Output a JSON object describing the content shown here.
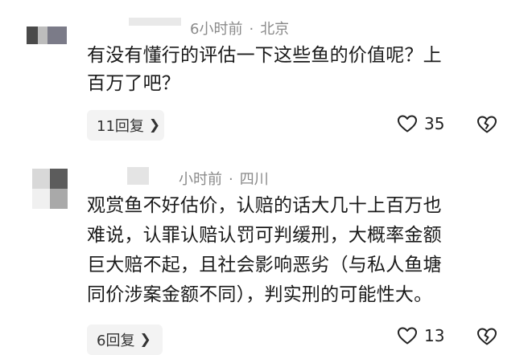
{
  "comments": [
    {
      "time": "6小时前",
      "separator": "·",
      "location": "北京",
      "lines": [
        "有没有懂行的评估一下这些鱼的价值呢？上",
        "百万了吧？"
      ],
      "replies_label": "11回复",
      "likes": "35"
    },
    {
      "time": "小时前",
      "separator": "·",
      "location": "四川",
      "lines": [
        "观赏鱼不好估价，认赔的话大几十上百万也",
        "难说，认罪认赔认罚可判缓刑，大概率金额",
        "巨大赔不起，且社会影响恶劣（与私人鱼塘",
        "同价涉案金额不同），判实刑的可能性大。"
      ],
      "replies_label": "6回复",
      "likes": "13"
    }
  ],
  "icons": {
    "like": "heart-outline-icon",
    "dislike": "broken-heart-icon",
    "reply_chevron": "chevron-right-icon"
  },
  "colors": {
    "meta_text": "#8a8a8a",
    "chip_background": "#f3f3f3",
    "body_text": "#1a1a1a"
  }
}
